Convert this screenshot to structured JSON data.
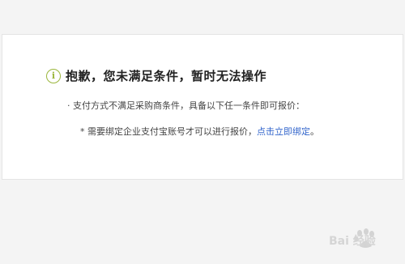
{
  "notice": {
    "icon": "info-circle-icon",
    "title": "抱歉，您未满足条件，暂时无法操作",
    "requirement_line": "· 支付方式不满足采购商条件，具备以下任一条件即可报价：",
    "condition_prefix": "* 需要绑定企业支付宝账号才可以进行报价，",
    "condition_link": "点击立即绑定",
    "condition_suffix": "。"
  },
  "watermark": {
    "text": "Bai 经验",
    "icon": "baidu-paw-logo"
  },
  "colors": {
    "page_background": "#f4f4f4",
    "card_background": "#ffffff",
    "icon_accent": "#9bb63c",
    "link": "#3366cc"
  }
}
